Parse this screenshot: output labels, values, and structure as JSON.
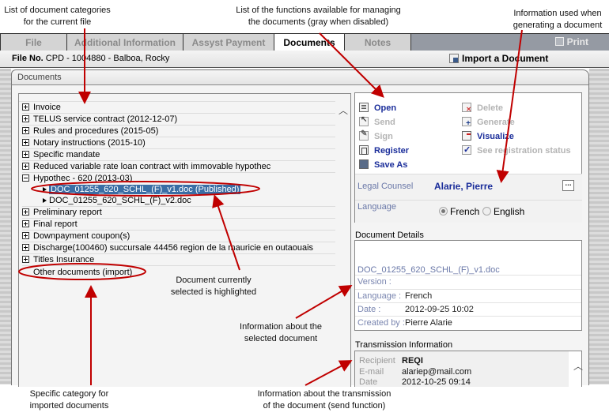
{
  "tabs": [
    {
      "label": "File",
      "active": false
    },
    {
      "label": "Additional Information",
      "active": false
    },
    {
      "label": "Assyst Payment",
      "active": false
    },
    {
      "label": "Documents",
      "active": true
    },
    {
      "label": "Notes",
      "active": false
    }
  ],
  "toolbar": {
    "print_label": "Print",
    "import_label": "Import a Document"
  },
  "file_header": {
    "prefix": "File No.",
    "value": "CPD - 1004880 - Balboa, Rocky"
  },
  "documents_panel": {
    "title": "Documents"
  },
  "tree": {
    "categories": [
      {
        "label": "Invoice",
        "expanded": false
      },
      {
        "label": "TELUS service contract (2012-12-07)",
        "expanded": false
      },
      {
        "label": "Rules and procedures (2015-05)",
        "expanded": false
      },
      {
        "label": "Notary instructions (2015-10)",
        "expanded": false
      },
      {
        "label": "Specific mandate",
        "expanded": false
      },
      {
        "label": "Reduced variable rate loan contract with immovable hypothec",
        "expanded": false
      },
      {
        "label": "Hypothec - 620 (2013-03)",
        "expanded": true,
        "children": [
          {
            "label": "DOC_01255_620_SCHL_(F)_v1.doc (Published)",
            "selected": true
          },
          {
            "label": "DOC_01255_620_SCHL_(F)_v2.doc",
            "selected": false
          }
        ]
      },
      {
        "label": "Preliminary report",
        "expanded": false
      },
      {
        "label": "Final report",
        "expanded": false
      },
      {
        "label": "Downpayment coupon(s)",
        "expanded": false
      },
      {
        "label": "Discharge(100460) succursale 44456 region de la mauricie en outaouais",
        "expanded": false
      },
      {
        "label": "Titles Insurance",
        "expanded": false
      }
    ],
    "other": "Other documents (import)"
  },
  "actions": {
    "left": [
      {
        "label": "Open",
        "enabled": true,
        "icon": "open-icon"
      },
      {
        "label": "Send",
        "enabled": false,
        "icon": "send-icon"
      },
      {
        "label": "Sign",
        "enabled": false,
        "icon": "sign-icon"
      },
      {
        "label": "Register",
        "enabled": true,
        "icon": "register-icon"
      },
      {
        "label": "Save As",
        "enabled": true,
        "icon": "save-icon"
      }
    ],
    "right": [
      {
        "label": "Delete",
        "enabled": false,
        "icon": "delete-icon"
      },
      {
        "label": "Generate",
        "enabled": false,
        "icon": "generate-icon"
      },
      {
        "label": "Visualize",
        "enabled": true,
        "icon": "visualize-icon"
      },
      {
        "label": "See registration status",
        "enabled": false,
        "icon": "check-icon"
      }
    ]
  },
  "generation": {
    "legal_counsel_label": "Legal Counsel",
    "legal_counsel_value": "Alarie, Pierre",
    "more_button": "...",
    "language_label": "Language",
    "language_options": [
      "French",
      "English"
    ],
    "language_selected": "French"
  },
  "document_details": {
    "title": "Document Details",
    "filename": "DOC_01255_620_SCHL_(F)_v1.doc",
    "rows": [
      {
        "key": "Version :",
        "value": ""
      },
      {
        "key": "Language :",
        "value": "French"
      },
      {
        "key": "Date :",
        "value": "2012-09-25 10:02"
      },
      {
        "key": "Created by :",
        "value": "Pierre Alarie"
      }
    ]
  },
  "transmission": {
    "title": "Transmission Information",
    "rows": [
      {
        "key": "Recipient",
        "value": "REQI"
      },
      {
        "key": "E-mail",
        "value": "alariep@mail.com"
      },
      {
        "key": "Date",
        "value": "2012-10-25 09:14"
      }
    ]
  },
  "annotations": {
    "categories": [
      "List of document categories",
      "for the current file"
    ],
    "functions": [
      "List of the functions available for managing",
      "the documents (gray when disabled)"
    ],
    "generation": [
      "Information used when",
      "generating a document"
    ],
    "selected": [
      "Document currently",
      "selected is highlighted"
    ],
    "doc_info": [
      "Information about the",
      "selected document"
    ],
    "import_cat": [
      "Specific category for",
      "imported documents"
    ],
    "transmission": [
      "Information about the transmission",
      "of the document (send function)"
    ]
  },
  "colors": {
    "accent_link": "#1a2d9a",
    "disabled": "#b4b4b4",
    "selection": "#3a6ea5",
    "annotation": "#c00000"
  }
}
